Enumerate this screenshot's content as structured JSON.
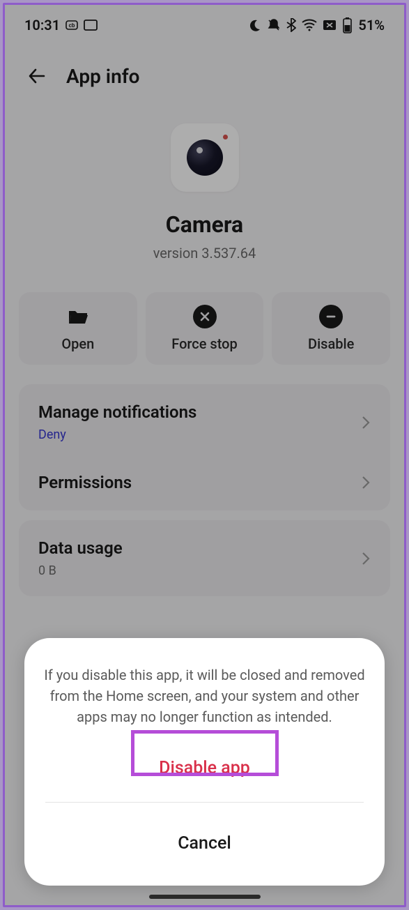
{
  "status": {
    "time": "10:31",
    "battery": "51%"
  },
  "header": {
    "title": "App info"
  },
  "app": {
    "name": "Camera",
    "version": "version 3.537.64"
  },
  "actions": {
    "open": "Open",
    "force_stop": "Force stop",
    "disable": "Disable"
  },
  "settings": {
    "notifications": {
      "title": "Manage notifications",
      "status": "Deny"
    },
    "permissions": {
      "title": "Permissions"
    },
    "data_usage": {
      "title": "Data usage",
      "value": "0 B"
    }
  },
  "dialog": {
    "message": "If you disable this app, it will be closed and removed from the Home screen, and your system and other apps may no longer function as intended.",
    "disable": "Disable app",
    "cancel": "Cancel"
  }
}
